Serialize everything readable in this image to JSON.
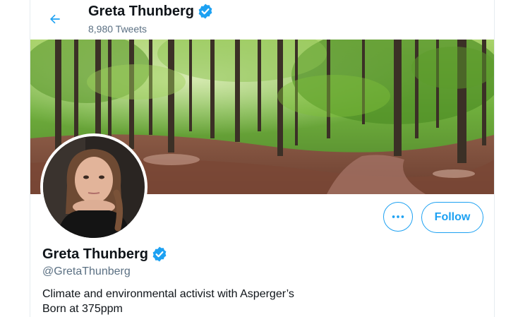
{
  "header": {
    "name": "Greta Thunberg",
    "tweet_count": "8,980 Tweets",
    "back_icon": "arrow-left-icon",
    "verified_icon": "verified-badge-icon"
  },
  "profile": {
    "name": "Greta Thunberg",
    "handle": "@GretaThunberg",
    "bio_lines": [
      "Climate and environmental activist with Asperger’s",
      "Born at 375ppm"
    ],
    "more_icon": "more-horizontal-icon",
    "follow_label": "Follow"
  },
  "colors": {
    "accent": "#1da1f2",
    "text_primary": "#0f1419",
    "text_secondary": "#5b7083",
    "border": "#e6ecf0"
  }
}
